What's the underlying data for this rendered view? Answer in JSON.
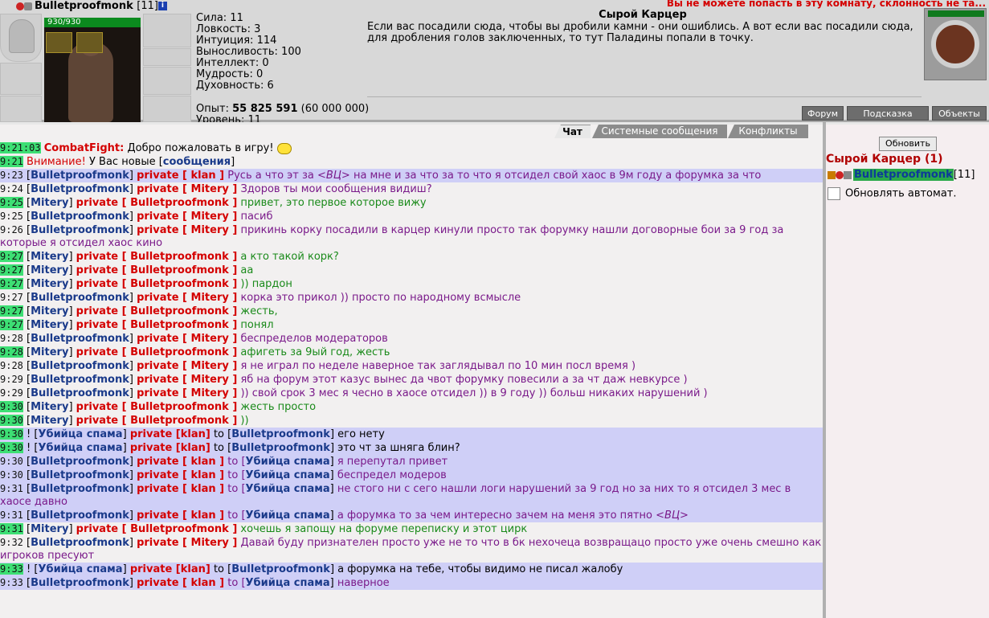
{
  "player": {
    "name": "Bulletproofmonk",
    "level": "[11]",
    "hp": "930/930"
  },
  "stats": [
    "Сила: 11",
    "Ловкость: 3",
    "Интуиция: 114",
    "Выносливость: 100",
    "Интеллект: 0",
    "Мудрость: 0",
    "Духовность: 6"
  ],
  "experience": {
    "label": "Опыт:",
    "value": "55 825 591",
    "next": "(60 000 000)"
  },
  "level_cut": "Уровень: 11",
  "warning": "Вы не можете попасть в эту комнату, склонность не та...",
  "room": {
    "title": "Сырой Карцер",
    "description": "Если вас посадили сюда, чтобы вы дробили камни - они ошиблись. А вот если вас посадили сюда, для дробления голов заключенных, то тут Паладины попали в точку."
  },
  "nav_buttons": [
    "Форум",
    "Подсказка",
    "Объекты"
  ],
  "tabs": [
    "Чат",
    "Системные сообщения",
    "Конфликты"
  ],
  "chat": [
    {
      "t": "9:21:03",
      "tg": true,
      "hl": false,
      "parts": [
        [
          "sys",
          "CombatFight:"
        ],
        [
          "dark",
          " Добро пожаловать в игру! "
        ]
      ],
      "smile": true
    },
    {
      "t": "9:21",
      "tg": true,
      "hl": false,
      "parts": [
        [
          "warn",
          "Внимание!"
        ],
        [
          "dark",
          " У Вас новые ["
        ],
        [
          "nick",
          "сообщения"
        ],
        [
          "dark",
          "]"
        ]
      ]
    },
    {
      "t": "9:23",
      "tg": false,
      "hl": true,
      "parts": [
        [
          "dark",
          "["
        ],
        [
          "nick",
          "Bulletproofmonk"
        ],
        [
          "dark",
          "] "
        ],
        [
          "priv",
          "private [ klan ]"
        ],
        [
          "purple",
          " Русь а что эт за "
        ],
        [
          "purple-it",
          "<ВЦ>"
        ],
        [
          "purple",
          " на мне и за что за то что я отсидел свой хаос в 9м году а форумка за что"
        ]
      ]
    },
    {
      "t": "9:24",
      "tg": false,
      "hl": false,
      "parts": [
        [
          "dark",
          "["
        ],
        [
          "nick",
          "Bulletproofmonk"
        ],
        [
          "dark",
          "] "
        ],
        [
          "priv",
          "private [ Mitery ]"
        ],
        [
          "purple",
          " Здоров ты мои сообщения видиш?"
        ]
      ]
    },
    {
      "t": "9:25",
      "tg": true,
      "hl": false,
      "parts": [
        [
          "dark",
          "["
        ],
        [
          "nick",
          "Mitery"
        ],
        [
          "dark",
          "] "
        ],
        [
          "priv",
          "private [ Bulletproofmonk ]"
        ],
        [
          "green",
          " привет, это первое которое вижу"
        ]
      ]
    },
    {
      "t": "9:25",
      "tg": false,
      "hl": false,
      "parts": [
        [
          "dark",
          "["
        ],
        [
          "nick",
          "Bulletproofmonk"
        ],
        [
          "dark",
          "] "
        ],
        [
          "priv",
          "private [ Mitery ]"
        ],
        [
          "purple",
          " пасиб"
        ]
      ]
    },
    {
      "t": "9:26",
      "tg": false,
      "hl": false,
      "parts": [
        [
          "dark",
          "["
        ],
        [
          "nick",
          "Bulletproofmonk"
        ],
        [
          "dark",
          "] "
        ],
        [
          "priv",
          "private [ Mitery ]"
        ],
        [
          "purple",
          " прикинь корку посадили в карцер кинули просто так форумку нашли договорные бои за 9 год за которые я отсидел хаос кино"
        ]
      ]
    },
    {
      "t": "9:27",
      "tg": true,
      "hl": false,
      "parts": [
        [
          "dark",
          "["
        ],
        [
          "nick",
          "Mitery"
        ],
        [
          "dark",
          "] "
        ],
        [
          "priv",
          "private [ Bulletproofmonk ]"
        ],
        [
          "green",
          " а кто такой корк?"
        ]
      ]
    },
    {
      "t": "9:27",
      "tg": true,
      "hl": false,
      "parts": [
        [
          "dark",
          "["
        ],
        [
          "nick",
          "Mitery"
        ],
        [
          "dark",
          "] "
        ],
        [
          "priv",
          "private [ Bulletproofmonk ]"
        ],
        [
          "green",
          " аа"
        ]
      ]
    },
    {
      "t": "9:27",
      "tg": true,
      "hl": false,
      "parts": [
        [
          "dark",
          "["
        ],
        [
          "nick",
          "Mitery"
        ],
        [
          "dark",
          "] "
        ],
        [
          "priv",
          "private [ Bulletproofmonk ]"
        ],
        [
          "green",
          " )) пардон"
        ]
      ]
    },
    {
      "t": "9:27",
      "tg": false,
      "hl": false,
      "parts": [
        [
          "dark",
          "["
        ],
        [
          "nick",
          "Bulletproofmonk"
        ],
        [
          "dark",
          "] "
        ],
        [
          "priv",
          "private [ Mitery ]"
        ],
        [
          "purple",
          " корка это прикол )) просто по народному всмысле"
        ]
      ]
    },
    {
      "t": "9:27",
      "tg": true,
      "hl": false,
      "parts": [
        [
          "dark",
          "["
        ],
        [
          "nick",
          "Mitery"
        ],
        [
          "dark",
          "] "
        ],
        [
          "priv",
          "private [ Bulletproofmonk ]"
        ],
        [
          "green",
          " жесть,"
        ]
      ]
    },
    {
      "t": "9:27",
      "tg": true,
      "hl": false,
      "parts": [
        [
          "dark",
          "["
        ],
        [
          "nick",
          "Mitery"
        ],
        [
          "dark",
          "] "
        ],
        [
          "priv",
          "private [ Bulletproofmonk ]"
        ],
        [
          "green",
          " понял"
        ]
      ]
    },
    {
      "t": "9:28",
      "tg": false,
      "hl": false,
      "parts": [
        [
          "dark",
          "["
        ],
        [
          "nick",
          "Bulletproofmonk"
        ],
        [
          "dark",
          "] "
        ],
        [
          "priv",
          "private [ Mitery ]"
        ],
        [
          "purple",
          " беспределов модераторов"
        ]
      ]
    },
    {
      "t": "9:28",
      "tg": true,
      "hl": false,
      "parts": [
        [
          "dark",
          "["
        ],
        [
          "nick",
          "Mitery"
        ],
        [
          "dark",
          "] "
        ],
        [
          "priv",
          "private [ Bulletproofmonk ]"
        ],
        [
          "green",
          " афигеть за 9ый год, жесть"
        ]
      ]
    },
    {
      "t": "9:28",
      "tg": false,
      "hl": false,
      "parts": [
        [
          "dark",
          "["
        ],
        [
          "nick",
          "Bulletproofmonk"
        ],
        [
          "dark",
          "] "
        ],
        [
          "priv",
          "private [ Mitery ]"
        ],
        [
          "purple",
          " я не играл по неделе наверное так заглядывал по 10 мин посл время )"
        ]
      ]
    },
    {
      "t": "9:29",
      "tg": false,
      "hl": false,
      "parts": [
        [
          "dark",
          "["
        ],
        [
          "nick",
          "Bulletproofmonk"
        ],
        [
          "dark",
          "] "
        ],
        [
          "priv",
          "private [ Mitery ]"
        ],
        [
          "purple",
          " яб на форум этот казус вынес да чвот форумку повесили а за чт даж невкурсе )"
        ]
      ]
    },
    {
      "t": "9:29",
      "tg": false,
      "hl": false,
      "parts": [
        [
          "dark",
          "["
        ],
        [
          "nick",
          "Bulletproofmonk"
        ],
        [
          "dark",
          "] "
        ],
        [
          "priv",
          "private [ Mitery ]"
        ],
        [
          "purple",
          " )) свой срок 3 мес я чесно в хаосе отсидел )) в 9 году )) больш никаких нарушений )"
        ]
      ]
    },
    {
      "t": "9:30",
      "tg": true,
      "hl": false,
      "parts": [
        [
          "dark",
          "["
        ],
        [
          "nick",
          "Mitery"
        ],
        [
          "dark",
          "] "
        ],
        [
          "priv",
          "private [ Bulletproofmonk ]"
        ],
        [
          "green",
          " жесть просто"
        ]
      ]
    },
    {
      "t": "9:30",
      "tg": true,
      "hl": false,
      "parts": [
        [
          "dark",
          "["
        ],
        [
          "nick",
          "Mitery"
        ],
        [
          "dark",
          "] "
        ],
        [
          "priv",
          "private [ Bulletproofmonk ]"
        ],
        [
          "green",
          " ))"
        ]
      ]
    },
    {
      "t": "9:30",
      "tg": true,
      "hl": true,
      "parts": [
        [
          "dark",
          "! ["
        ],
        [
          "nick",
          "Убийца спама"
        ],
        [
          "dark",
          "] "
        ],
        [
          "priv",
          "private [klan]"
        ],
        [
          "dark",
          " to ["
        ],
        [
          "nick",
          "Bulletproofmonk"
        ],
        [
          "dark",
          "] его нету"
        ]
      ]
    },
    {
      "t": "9:30",
      "tg": true,
      "hl": true,
      "parts": [
        [
          "dark",
          "! ["
        ],
        [
          "nick",
          "Убийца спама"
        ],
        [
          "dark",
          "] "
        ],
        [
          "priv",
          "private [klan]"
        ],
        [
          "dark",
          " to ["
        ],
        [
          "nick",
          "Bulletproofmonk"
        ],
        [
          "dark",
          "] это чт за шняга блин?"
        ]
      ]
    },
    {
      "t": "9:30",
      "tg": false,
      "hl": true,
      "parts": [
        [
          "dark",
          "["
        ],
        [
          "nick",
          "Bulletproofmonk"
        ],
        [
          "dark",
          "] "
        ],
        [
          "priv",
          "private [ klan ]"
        ],
        [
          "purple",
          " to ["
        ],
        [
          "nick",
          "Убийца спама"
        ],
        [
          "dark",
          "]"
        ],
        [
          "purple",
          " я перепутал привет"
        ]
      ]
    },
    {
      "t": "9:30",
      "tg": false,
      "hl": true,
      "parts": [
        [
          "dark",
          "["
        ],
        [
          "nick",
          "Bulletproofmonk"
        ],
        [
          "dark",
          "] "
        ],
        [
          "priv",
          "private [ klan ]"
        ],
        [
          "purple",
          " to ["
        ],
        [
          "nick",
          "Убийца спама"
        ],
        [
          "dark",
          "]"
        ],
        [
          "purple",
          " беспредел модеров"
        ]
      ]
    },
    {
      "t": "9:31",
      "tg": false,
      "hl": true,
      "parts": [
        [
          "dark",
          "["
        ],
        [
          "nick",
          "Bulletproofmonk"
        ],
        [
          "dark",
          "] "
        ],
        [
          "priv",
          "private [ klan ]"
        ],
        [
          "purple",
          " to ["
        ],
        [
          "nick",
          "Убийца спама"
        ],
        [
          "dark",
          "]"
        ],
        [
          "purple",
          " не стого ни с сего нашли логи нарушений за 9 год но за них то я отсидел 3 мес в хаосе давно"
        ]
      ]
    },
    {
      "t": "9:31",
      "tg": false,
      "hl": true,
      "parts": [
        [
          "dark",
          "["
        ],
        [
          "nick",
          "Bulletproofmonk"
        ],
        [
          "dark",
          "] "
        ],
        [
          "priv",
          "private [ klan ]"
        ],
        [
          "purple",
          " to ["
        ],
        [
          "nick",
          "Убийца спама"
        ],
        [
          "dark",
          "]"
        ],
        [
          "purple",
          " а форумка то за чем интересно зачем на меня это пятно "
        ],
        [
          "purple-it",
          "<ВЦ>"
        ]
      ]
    },
    {
      "t": "9:31",
      "tg": true,
      "hl": false,
      "parts": [
        [
          "dark",
          "["
        ],
        [
          "nick",
          "Mitery"
        ],
        [
          "dark",
          "] "
        ],
        [
          "priv",
          "private [ Bulletproofmonk ]"
        ],
        [
          "green",
          " хочешь я запощу на форуме переписку и этот цирк"
        ]
      ]
    },
    {
      "t": "9:32",
      "tg": false,
      "hl": false,
      "parts": [
        [
          "dark",
          "["
        ],
        [
          "nick",
          "Bulletproofmonk"
        ],
        [
          "dark",
          "] "
        ],
        [
          "priv",
          "private [ Mitery ]"
        ],
        [
          "purple",
          " Давай буду признателен просто уже не то что в бк нехочеца возвращацо просто уже очень смешно как игроков пресуют"
        ]
      ]
    },
    {
      "t": "9:33",
      "tg": true,
      "hl": true,
      "parts": [
        [
          "dark",
          "! ["
        ],
        [
          "nick",
          "Убийца спама"
        ],
        [
          "dark",
          "] "
        ],
        [
          "priv",
          "private [klan]"
        ],
        [
          "dark",
          " to ["
        ],
        [
          "nick",
          "Bulletproofmonk"
        ],
        [
          "dark",
          "] а форумка на тебе, чтобы видимо не писал жалобу"
        ]
      ]
    },
    {
      "t": "9:33",
      "tg": false,
      "hl": true,
      "parts": [
        [
          "dark",
          "["
        ],
        [
          "nick",
          "Bulletproofmonk"
        ],
        [
          "dark",
          "] "
        ],
        [
          "priv",
          "private [ klan ]"
        ],
        [
          "purple",
          " to ["
        ],
        [
          "nick",
          "Убийца спама"
        ],
        [
          "dark",
          "]"
        ],
        [
          "purple",
          " наверное"
        ]
      ]
    }
  ],
  "side": {
    "refresh": "Обновить",
    "room_title": "Сырой Карцер (1)",
    "user_name": "Bulletproofmonk",
    "user_level": "[11]",
    "auto_label": "Обновлять автомат."
  }
}
